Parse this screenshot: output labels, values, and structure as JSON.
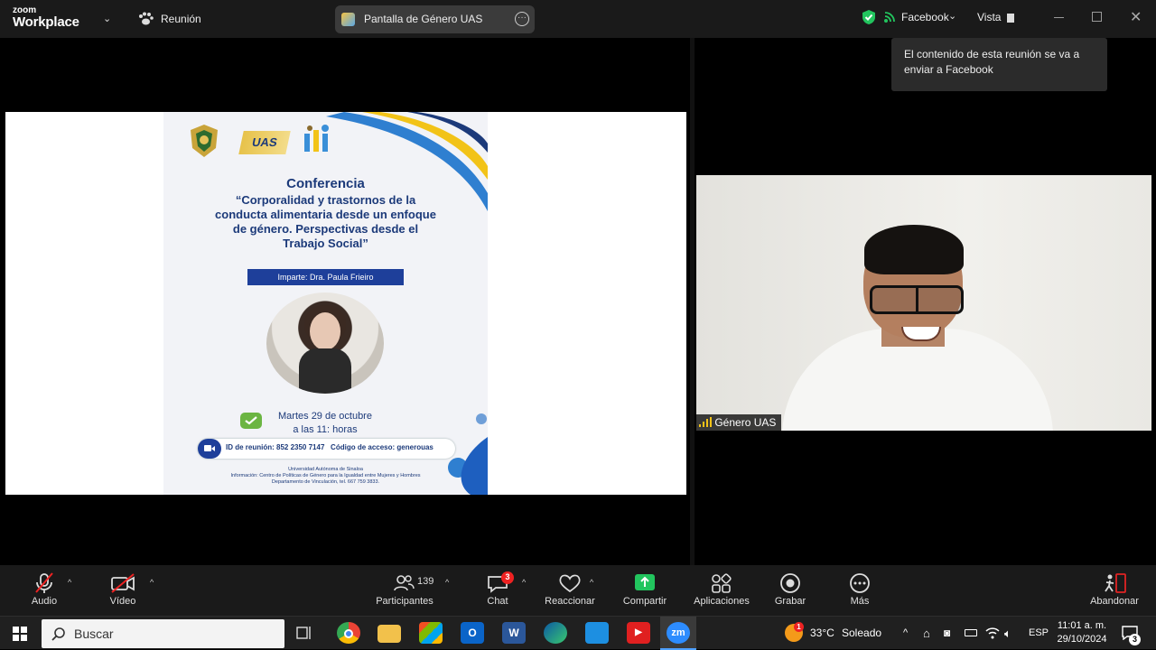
{
  "titlebar": {
    "logo_top": "zoom",
    "logo_bottom": "Workplace",
    "meeting_label": "Reunión",
    "share_title": "Pantalla de Género UAS",
    "stream_label": "Facebook",
    "view_label": "Vista",
    "stream_tooltip": "El contenido de esta reunión se va a enviar a Facebook"
  },
  "slide": {
    "logo_text": "UAS",
    "conference_heading": "Conferencia",
    "talk_title": "“Corporalidad y trastornos de la conducta alimentaria desde un enfoque de género. Perspectivas desde el Trabajo Social”",
    "speaker": "Imparte: Dra. Paula Frieiro",
    "date_line1": "Martes 29 de octubre",
    "date_line2": "a las 11: horas",
    "meeting_info": "ID de reunión: 852 2350 7147   Código de acceso: generouas",
    "footer_line1": "Universidad Autónoma de Sinaloa",
    "footer_line2": "Información: Centro de Políticas de Género para la Igualdad entre Mujeres y Hombres",
    "footer_line3": "Departamento de Vinculación, tel. 667 759 3833."
  },
  "video": {
    "participant_name": "Género UAS"
  },
  "controls": {
    "audio": "Audio",
    "video": "Vídeo",
    "participants": "Participantes",
    "participants_count": "139",
    "chat": "Chat",
    "chat_badge": "3",
    "react": "Reaccionar",
    "share": "Compartir",
    "apps": "Aplicaciones",
    "record": "Grabar",
    "more": "Más",
    "leave": "Abandonar"
  },
  "taskbar": {
    "search_placeholder": "Buscar",
    "zoom_app": "zm",
    "weather_temp": "33°C",
    "weather_desc": "Soleado",
    "weather_badge": "1",
    "language": "ESP",
    "time": "11:01 a. m.",
    "date": "29/10/2024",
    "notification_count": "3"
  },
  "colors": {
    "accent_green": "#22c55e",
    "slide_blue": "#1e3f9a",
    "leave_red": "#e02424"
  }
}
